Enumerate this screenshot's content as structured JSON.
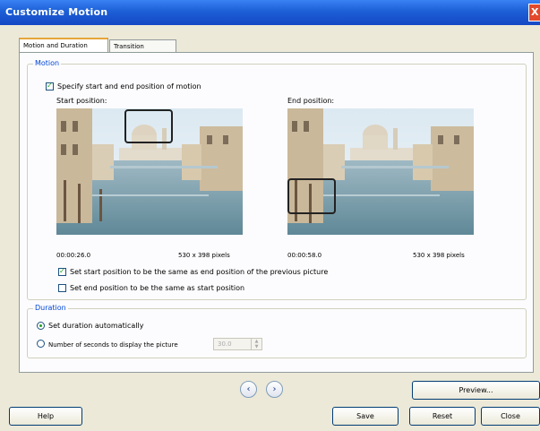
{
  "window": {
    "title": "Customize Motion",
    "close_label": "X"
  },
  "tabs": [
    {
      "label": "Motion and Duration",
      "active": true
    },
    {
      "label": "Transition",
      "active": false
    }
  ],
  "motion": {
    "group_label": "Motion",
    "specify_checkbox": {
      "label": "Specify start and end position of motion",
      "checked": true
    },
    "start": {
      "label": "Start position:",
      "time": "00:00:26.0",
      "size": "530 x 398 pixels"
    },
    "end": {
      "label": "End position:",
      "time": "00:00:58.0",
      "size": "530 x 398 pixels"
    },
    "same_as_prev_checkbox": {
      "label": "Set start position to be the same as end position of the previous picture",
      "checked": true
    },
    "end_same_as_start_checkbox": {
      "label": "Set end position to be the same as start position",
      "checked": false
    }
  },
  "duration": {
    "group_label": "Duration",
    "auto_radio": {
      "label": "Set duration automatically",
      "checked": true
    },
    "seconds_radio": {
      "label": "Number of seconds to display the picture",
      "checked": false
    },
    "seconds_value": "30.0"
  },
  "buttons": {
    "prev_icon": "arrow-left-icon",
    "next_icon": "arrow-right-icon",
    "preview": "Preview...",
    "help": "Help",
    "save": "Save",
    "reset": "Reset",
    "close": "Close"
  },
  "colors": {
    "titlebar": "#1c5fd6",
    "group_label": "#0046d5",
    "check_mark": "#21a121",
    "active_tab_accent": "#e6a53a"
  }
}
